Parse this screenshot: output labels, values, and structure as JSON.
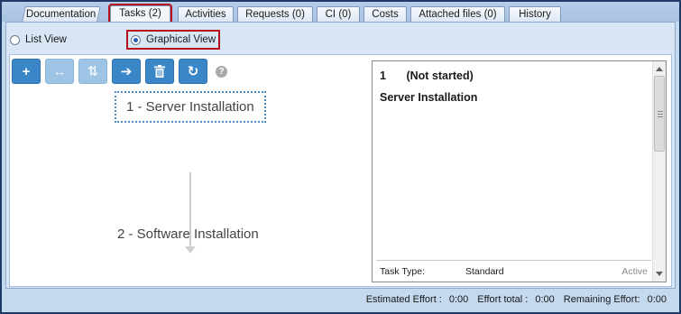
{
  "tabs": [
    {
      "label": "Documentation"
    },
    {
      "label": "Tasks (2)",
      "active": true
    },
    {
      "label": "Activities"
    },
    {
      "label": "Requests (0)"
    },
    {
      "label": "CI (0)"
    },
    {
      "label": "Costs"
    },
    {
      "label": "Attached files (0)"
    },
    {
      "label": "History"
    }
  ],
  "view_options": {
    "list_view": "List View",
    "graphical_view": "Graphical View",
    "selected": "graphical_view"
  },
  "toolbar": {
    "add": "+",
    "move_horizontal": "↔",
    "move_vertical": "⇅",
    "go": "➔",
    "delete": "🗑",
    "refresh": "↻",
    "help": "?"
  },
  "icons": {
    "add": "add-icon",
    "move_horizontal": "move-horizontal-icon",
    "move_vertical": "move-vertical-icon",
    "go": "arrow-right-icon",
    "delete": "trash-icon",
    "refresh": "refresh-icon",
    "help": "help-icon"
  },
  "graph": {
    "nodes": [
      {
        "label": "1 - Server Installation",
        "selected": true
      },
      {
        "label": "2 - Software Installation",
        "selected": false
      }
    ]
  },
  "detail": {
    "number": "1",
    "status": "(Not started)",
    "title": "Server Installation",
    "task_type_label": "Task Type:",
    "task_type_value": "Standard",
    "state": "Active"
  },
  "status_bar": {
    "estimated_effort_label": "Estimated Effort :",
    "estimated_effort_value": "0:00",
    "effort_total_label": "Effort total :",
    "effort_total_value": "0:00",
    "remaining_effort_label": "Remaining Effort:",
    "remaining_effort_value": "0:00"
  },
  "colors": {
    "accent": "#3a86c7",
    "highlight": "#b5121b",
    "panel_background": "#d7e5f4"
  }
}
